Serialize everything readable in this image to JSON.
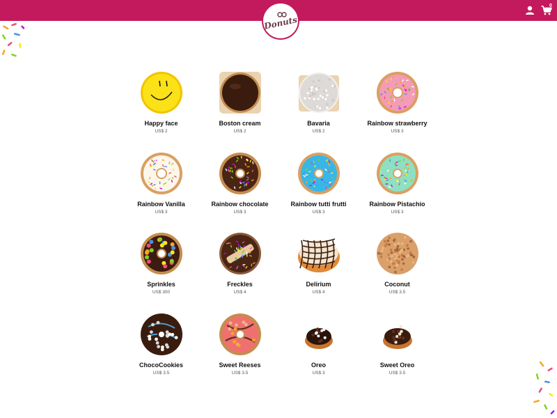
{
  "header": {
    "brand": "Donuts",
    "background": "#c21a5c",
    "icons": [
      "user-icon",
      "cart-icon"
    ],
    "cart_count": "0"
  },
  "products": [
    {
      "name": "Happy face",
      "price": "US$ 2",
      "style": "happy"
    },
    {
      "name": "Boston cream",
      "price": "US$ 2",
      "style": "boston"
    },
    {
      "name": "Bavaria",
      "price": "US$ 2",
      "style": "bavaria"
    },
    {
      "name": "Rainbow strawberry",
      "price": "US$ 3",
      "style": "pinkring"
    },
    {
      "name": "Rainbow Vanilla",
      "price": "US$ 3",
      "style": "vanilla"
    },
    {
      "name": "Rainbow chocolate",
      "price": "US$ 3",
      "style": "choc"
    },
    {
      "name": "Rainbow tutti frutti",
      "price": "US$ 3",
      "style": "blue"
    },
    {
      "name": "Rainbow Pistachio",
      "price": "US$ 3",
      "style": "mint"
    },
    {
      "name": "Sprinkles",
      "price": "US$ 300",
      "style": "candy"
    },
    {
      "name": "Freckles",
      "price": "US$ 4",
      "style": "freckles"
    },
    {
      "name": "Delirium",
      "price": "US$ 4",
      "style": "delirium"
    },
    {
      "name": "Coconut",
      "price": "US$ 3.5",
      "style": "coconut"
    },
    {
      "name": "ChocoCookies",
      "price": "US$ 3.5",
      "style": "cookies"
    },
    {
      "name": "Sweet Reeses",
      "price": "US$ 3.5",
      "style": "reeses"
    },
    {
      "name": "Oreo",
      "price": "US$ 3",
      "style": "oreo"
    },
    {
      "name": "Sweet Oreo",
      "price": "US$ 3.5",
      "style": "sweetoreo"
    }
  ]
}
